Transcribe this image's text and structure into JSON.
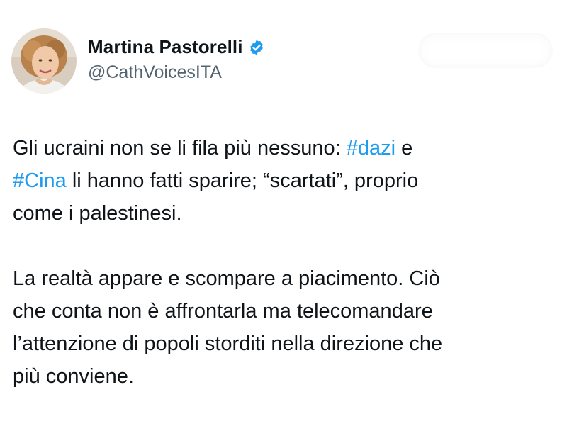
{
  "author": {
    "display_name": "Martina Pastorelli",
    "handle": "@CathVoicesITA",
    "verified": true,
    "verified_color": "#1d9bf0",
    "avatar_icon": "profile-photo"
  },
  "tweet": {
    "paragraph1": {
      "part1": "Gli ucraini non se li fila più nessuno: ",
      "hashtag1": "#dazi",
      "part2": " e\n",
      "hashtag2": "#Cina",
      "part3": " li hanno fatti sparire; “scartati”, proprio\ncome i palestinesi."
    },
    "paragraph2": "La realtà appare e scompare a piacimento. Ciò\nche conta non è affrontarla ma telecomandare\nl’attenzione di popoli storditi nella direzione che\npiù conviene."
  },
  "colors": {
    "text": "#0f1419",
    "secondary": "#536471",
    "link": "#1d9bf0"
  }
}
